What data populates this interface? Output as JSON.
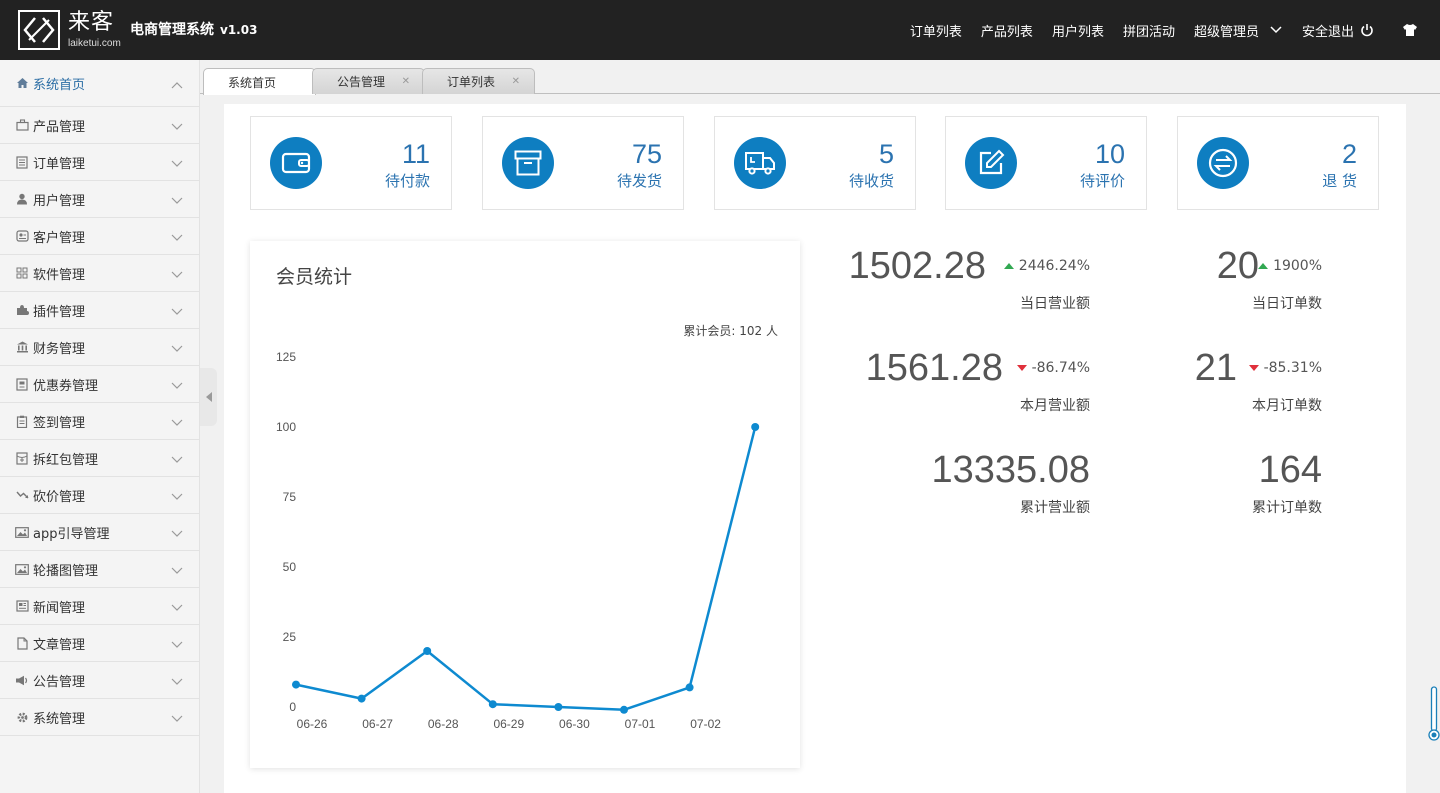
{
  "brand": {
    "logo_cn": "来客",
    "logo_en": "laiketui.com",
    "title": "电商管理系统",
    "version": "v1.03"
  },
  "topnav": {
    "items": [
      "订单列表",
      "产品列表",
      "用户列表",
      "拼团活动"
    ],
    "admin": "超级管理员",
    "logout": "安全退出"
  },
  "sidebar": {
    "items": [
      {
        "label": "系统首页",
        "icon": "home-icon"
      },
      {
        "label": "产品管理",
        "icon": "briefcase-icon"
      },
      {
        "label": "订单管理",
        "icon": "list-icon"
      },
      {
        "label": "用户管理",
        "icon": "user-icon"
      },
      {
        "label": "客户管理",
        "icon": "contact-icon"
      },
      {
        "label": "软件管理",
        "icon": "grid-icon"
      },
      {
        "label": "插件管理",
        "icon": "puzzle-icon"
      },
      {
        "label": "财务管理",
        "icon": "bank-icon"
      },
      {
        "label": "优惠券管理",
        "icon": "coupon-icon"
      },
      {
        "label": "签到管理",
        "icon": "clipboard-icon"
      },
      {
        "label": "拆红包管理",
        "icon": "redpacket-icon"
      },
      {
        "label": "砍价管理",
        "icon": "trend-icon"
      },
      {
        "label": "app引导管理",
        "icon": "image-icon"
      },
      {
        "label": "轮播图管理",
        "icon": "image-icon"
      },
      {
        "label": "新闻管理",
        "icon": "newspaper-icon"
      },
      {
        "label": "文章管理",
        "icon": "file-icon"
      },
      {
        "label": "公告管理",
        "icon": "megaphone-icon"
      },
      {
        "label": "系统管理",
        "icon": "gear-icon"
      }
    ]
  },
  "tabs": [
    {
      "label": "系统首页",
      "closable": false
    },
    {
      "label": "公告管理",
      "closable": true
    },
    {
      "label": "订单列表",
      "closable": true
    }
  ],
  "stats": [
    {
      "value": "11",
      "label": "待付款",
      "icon": "wallet-icon"
    },
    {
      "value": "75",
      "label": "待发货",
      "icon": "archive-box-icon"
    },
    {
      "value": "5",
      "label": "待收货",
      "icon": "delivery-truck-icon"
    },
    {
      "value": "10",
      "label": "待评价",
      "icon": "edit-icon"
    },
    {
      "value": "2",
      "label": "退 货",
      "icon": "exchange-icon"
    }
  ],
  "member_chart": {
    "title": "会员统计",
    "total_label": "累计会员: 102 人"
  },
  "metrics": {
    "today_revenue": {
      "value": "1502.28",
      "change": "2446.24%",
      "label": "当日营业额",
      "direction": "up"
    },
    "today_orders": {
      "value": "20",
      "change": "1900%",
      "label": "当日订单数",
      "direction": "up"
    },
    "month_revenue": {
      "value": "1561.28",
      "change": "-86.74%",
      "label": "本月营业额",
      "direction": "down"
    },
    "month_orders": {
      "value": "21",
      "change": "-85.31%",
      "label": "本月订单数",
      "direction": "down"
    },
    "total_revenue": {
      "value": "13335.08",
      "label": "累计营业额"
    },
    "total_orders": {
      "value": "164",
      "label": "累计订单数"
    }
  },
  "colors": {
    "topbar": "#222222",
    "accent": "#0e7ec1",
    "stat_text": "#2b73b0",
    "line": "#0e8ad0",
    "up": "#32a852",
    "down": "#e0303b"
  },
  "chart_data": {
    "type": "line",
    "title": "会员统计",
    "categories": [
      "06-26",
      "06-27",
      "06-28",
      "06-29",
      "06-30",
      "07-01",
      "07-02",
      ""
    ],
    "series": [
      {
        "values": [
          8,
          3,
          20,
          1,
          0,
          -1,
          7,
          100
        ]
      }
    ],
    "yticks": [
      0,
      25,
      50,
      75,
      100,
      125
    ],
    "ylim": [
      0,
      125
    ],
    "grid": false,
    "annotation": "累计会员: 102 人"
  }
}
